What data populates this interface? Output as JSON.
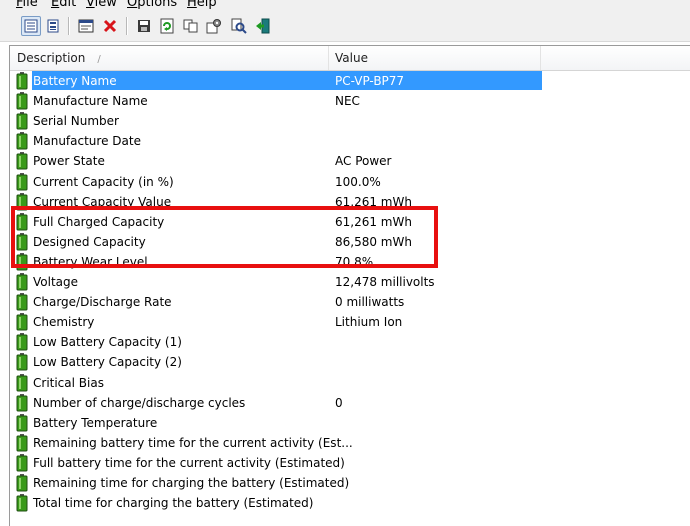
{
  "menu": {
    "items": [
      {
        "first": "F",
        "rest": "ile"
      },
      {
        "first": "E",
        "rest": "dit"
      },
      {
        "first": "V",
        "rest": "iew"
      },
      {
        "first": "O",
        "rest": "ptions"
      },
      {
        "first": "H",
        "rest": "elp"
      }
    ]
  },
  "toolbar": {
    "icons": [
      "html-report-icon",
      "details-view-icon",
      "properties-icon",
      "delete-icon",
      "save-icon",
      "refresh-icon",
      "copy-icon",
      "options-icon",
      "find-icon",
      "exit-icon"
    ]
  },
  "table": {
    "columns": [
      "Description",
      "Value"
    ],
    "sort_indicator": "/",
    "rows": [
      {
        "desc": "Battery Name",
        "val": "PC-VP-BP77"
      },
      {
        "desc": "Manufacture Name",
        "val": "NEC"
      },
      {
        "desc": "Serial Number",
        "val": ""
      },
      {
        "desc": "Manufacture Date",
        "val": ""
      },
      {
        "desc": "Power State",
        "val": "AC Power"
      },
      {
        "desc": "Current Capacity (in %)",
        "val": "100.0%"
      },
      {
        "desc": "Current Capacity Value",
        "val": "61,261 mWh"
      },
      {
        "desc": "Full Charged Capacity",
        "val": "61,261 mWh"
      },
      {
        "desc": "Designed Capacity",
        "val": "86,580 mWh"
      },
      {
        "desc": "Battery Wear Level",
        "val": "70.8%"
      },
      {
        "desc": "Voltage",
        "val": "12,478 millivolts"
      },
      {
        "desc": "Charge/Discharge Rate",
        "val": "0 milliwatts"
      },
      {
        "desc": "Chemistry",
        "val": "Lithium Ion"
      },
      {
        "desc": "Low Battery Capacity (1)",
        "val": ""
      },
      {
        "desc": "Low Battery Capacity (2)",
        "val": ""
      },
      {
        "desc": "Critical Bias",
        "val": ""
      },
      {
        "desc": "Number of charge/discharge cycles",
        "val": "0"
      },
      {
        "desc": "Battery Temperature",
        "val": ""
      },
      {
        "desc": "Remaining battery time for the current activity (Est...",
        "val": ""
      },
      {
        "desc": "Full battery time for the current activity (Estimated)",
        "val": ""
      },
      {
        "desc": "Remaining time for charging the battery (Estimated)",
        "val": ""
      },
      {
        "desc": "Total  time for charging the battery (Estimated)",
        "val": ""
      }
    ]
  },
  "colors": {
    "selection": "#3399ff",
    "highlight_box": "#e8100f",
    "battery_green": "#3a9a1a"
  }
}
